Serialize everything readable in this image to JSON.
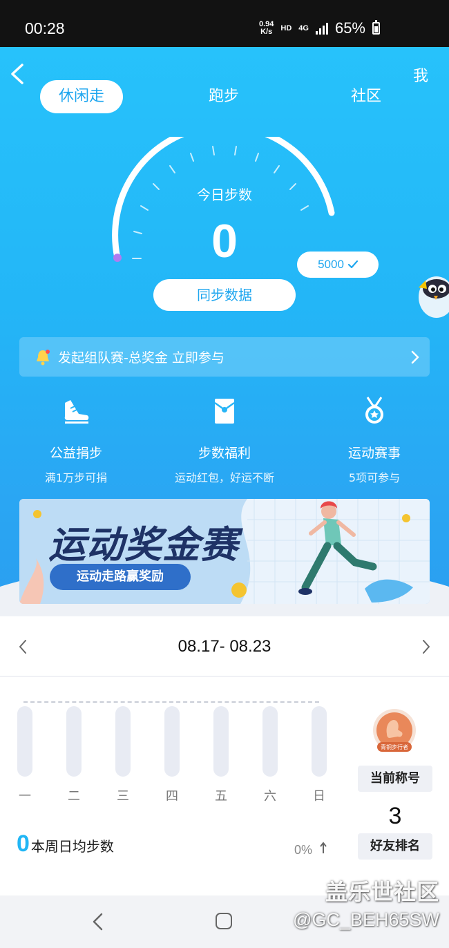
{
  "status_bar": {
    "time": "00:28",
    "net_speed_value": "0.94",
    "net_speed_unit": "K/s",
    "hd": "HD",
    "network": "4G",
    "battery": "65%"
  },
  "header": {
    "me_label": "我",
    "tabs": [
      {
        "label": "休闲走",
        "active": true
      },
      {
        "label": "跑步",
        "active": false
      },
      {
        "label": "社区",
        "active": false
      }
    ]
  },
  "gauge": {
    "title": "今日步数",
    "steps": "0",
    "goal": "5000",
    "sync_label": "同步数据",
    "progress": 0
  },
  "notice": {
    "text": "发起组队赛-总奖金 立即参与"
  },
  "features": [
    {
      "icon": "sneaker-icon",
      "title": "公益捐步",
      "subtitle": "满1万步可捐"
    },
    {
      "icon": "red-envelope-icon",
      "title": "步数福利",
      "subtitle": "运动红包，好运不断"
    },
    {
      "icon": "medal-icon",
      "title": "运动赛事",
      "subtitle": "5项可参与"
    }
  ],
  "promo": {
    "title": "运动奖金赛",
    "subtitle": "运动走路赢奖励"
  },
  "week": {
    "range": "08.17- 08.23",
    "days": [
      "一",
      "二",
      "三",
      "四",
      "五",
      "六",
      "日"
    ],
    "steps": [
      0,
      0,
      0,
      0,
      0,
      0,
      0
    ],
    "avg_value": "0",
    "avg_label": "本周日均步数",
    "change": "0%",
    "badge_text": "青铜步行者",
    "title_label": "当前称号",
    "rank_value": "3",
    "rank_label": "好友排名"
  },
  "watermark": {
    "line1": "盖乐世社区",
    "line2": "@GC_BEH65SW"
  },
  "colors": {
    "accent": "#1ea6ef",
    "hero_top": "#27c2fb",
    "hero_bottom": "#2b9ef0",
    "promo_title": "#1e3266",
    "avg_number": "#21b6f5"
  }
}
